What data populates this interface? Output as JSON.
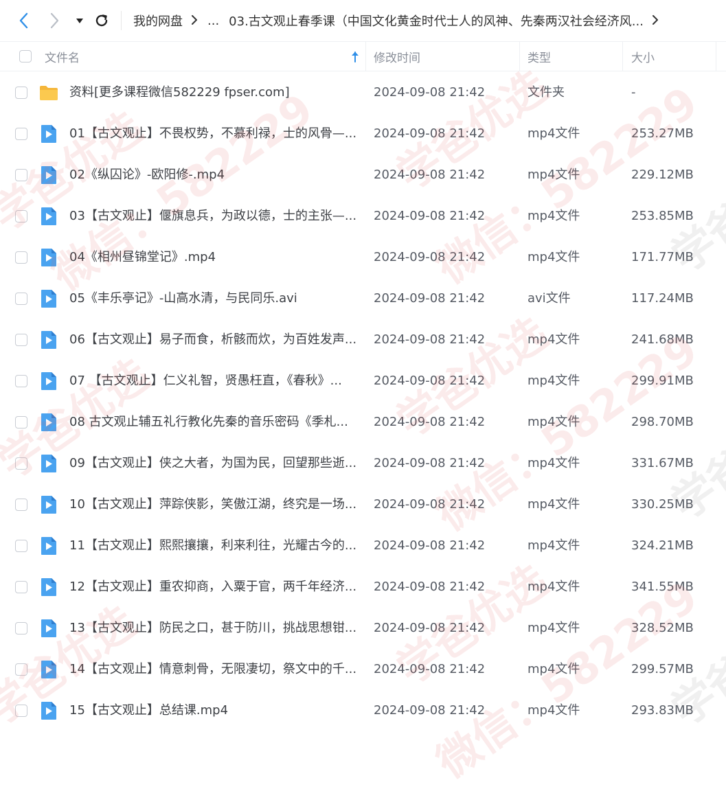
{
  "breadcrumb": {
    "root": "我的网盘",
    "ellipsis": "...",
    "current": "03.古文观止春季课（中国文化黄金时代士人的风神、先秦两汉社会经济风..."
  },
  "columns": {
    "name": "文件名",
    "modified": "修改时间",
    "type": "类型",
    "size": "大小"
  },
  "files": [
    {
      "name": "资料[更多课程微信582229 fpser.com]",
      "time": "2024-09-08 21:42",
      "type": "文件夹",
      "size": "-",
      "icon": "folder-icon"
    },
    {
      "name": "01【古文观止】不畏权势，不慕利禄，士的风骨—...",
      "time": "2024-09-08 21:42",
      "type": "mp4文件",
      "size": "253.27MB",
      "icon": "video-file-icon"
    },
    {
      "name": "02《纵囚论》-欧阳修-.mp4",
      "time": "2024-09-08 21:42",
      "type": "mp4文件",
      "size": "229.12MB",
      "icon": "video-file-icon"
    },
    {
      "name": "03【古文观止】偃旗息兵，为政以德，士的主张—...",
      "time": "2024-09-08 21:42",
      "type": "mp4文件",
      "size": "253.85MB",
      "icon": "video-file-icon"
    },
    {
      "name": "04《相州昼锦堂记》.mp4",
      "time": "2024-09-08 21:42",
      "type": "mp4文件",
      "size": "171.77MB",
      "icon": "video-file-icon"
    },
    {
      "name": "05《丰乐亭记》-山高水清，与民同乐.avi",
      "time": "2024-09-08 21:42",
      "type": "avi文件",
      "size": "117.24MB",
      "icon": "video-file-icon"
    },
    {
      "name": "06【古文观止】易子而食，析骸而炊，为百姓发声...",
      "time": "2024-09-08 21:42",
      "type": "mp4文件",
      "size": "241.68MB",
      "icon": "video-file-icon"
    },
    {
      "name": "07 【古文观止】仁义礼智，贤愚枉直，《春秋》...",
      "time": "2024-09-08 21:42",
      "type": "mp4文件",
      "size": "299.91MB",
      "icon": "video-file-icon"
    },
    {
      "name": "08 古文观止辅五礼行教化先秦的音乐密码《季札...",
      "time": "2024-09-08 21:42",
      "type": "mp4文件",
      "size": "298.70MB",
      "icon": "video-file-icon"
    },
    {
      "name": "09【古文观止】侠之大者，为国为民，回望那些逝...",
      "time": "2024-09-08 21:42",
      "type": "mp4文件",
      "size": "331.67MB",
      "icon": "video-file-icon"
    },
    {
      "name": "10【古文观止】萍踪侠影，笑傲江湖，终究是一场...",
      "time": "2024-09-08 21:42",
      "type": "mp4文件",
      "size": "330.25MB",
      "icon": "video-file-icon"
    },
    {
      "name": "11【古文观止】熙熙攘攘，利来利往，光耀古今的...",
      "time": "2024-09-08 21:42",
      "type": "mp4文件",
      "size": "324.21MB",
      "icon": "video-file-icon"
    },
    {
      "name": "12【古文观止】重农抑商，入粟于官，两千年经济...",
      "time": "2024-09-08 21:42",
      "type": "mp4文件",
      "size": "341.55MB",
      "icon": "video-file-icon"
    },
    {
      "name": "13【古文观止】防民之口，甚于防川，挑战思想钳...",
      "time": "2024-09-08 21:42",
      "type": "mp4文件",
      "size": "328.52MB",
      "icon": "video-file-icon"
    },
    {
      "name": "14【古文观止】情意刺骨，无限凄切，祭文中的千...",
      "time": "2024-09-08 21:42",
      "type": "mp4文件",
      "size": "299.57MB",
      "icon": "video-file-icon"
    },
    {
      "name": "15【古文观止】总结课.mp4",
      "time": "2024-09-08 21:42",
      "type": "mp4文件",
      "size": "293.83MB",
      "icon": "video-file-icon"
    }
  ],
  "watermarks": [
    "学爸优选",
    "微信：582229"
  ],
  "colors": {
    "accent": "#2f8fe8",
    "folder": "#f7c24a",
    "video": "#4aa3f0"
  }
}
